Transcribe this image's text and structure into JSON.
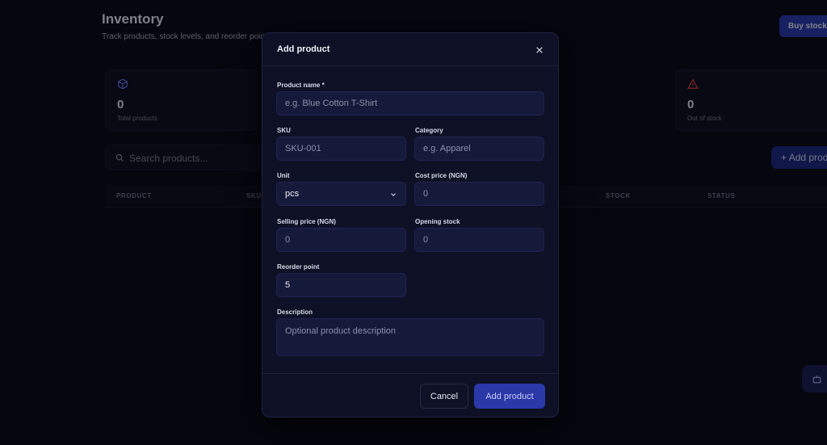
{
  "page": {
    "title": "Inventory",
    "subtitle": "Track products, stock levels, and reorder points",
    "buy_stock_label": "Buy stock",
    "stats": [
      {
        "icon": "cube-icon",
        "value": "0",
        "label": "Total products"
      },
      {
        "icon": "alert-triangle-icon",
        "value": "0",
        "label": "Out of stock"
      }
    ],
    "search_placeholder": "Search products...",
    "add_product_label": "Add product",
    "table_headers": [
      "PRODUCT",
      "SKU",
      "STOCK",
      "STATUS"
    ]
  },
  "modal": {
    "title": "Add product",
    "fields": {
      "product_name": {
        "label": "Product name *",
        "placeholder": "e.g. Blue Cotton T-Shirt"
      },
      "sku": {
        "label": "SKU",
        "placeholder": "SKU-001"
      },
      "category": {
        "label": "Category",
        "placeholder": "e.g. Apparel"
      },
      "unit": {
        "label": "Unit",
        "value": "pcs"
      },
      "cost_price": {
        "label": "Cost price (NGN)",
        "placeholder": "0"
      },
      "selling_price": {
        "label": "Selling price (NGN)",
        "placeholder": "0"
      },
      "opening_stock": {
        "label": "Opening stock",
        "placeholder": "0"
      },
      "reorder_point": {
        "label": "Reorder point",
        "value": "5"
      },
      "description": {
        "label": "Description",
        "placeholder": "Optional product description"
      }
    },
    "cancel_label": "Cancel",
    "submit_label": "Add product"
  },
  "colors": {
    "background": "#05060f",
    "modal": "#0e1125",
    "input": "#161a3a",
    "accent": "#2a38a8",
    "danger": "#ef4444",
    "info": "#6b7cff"
  }
}
